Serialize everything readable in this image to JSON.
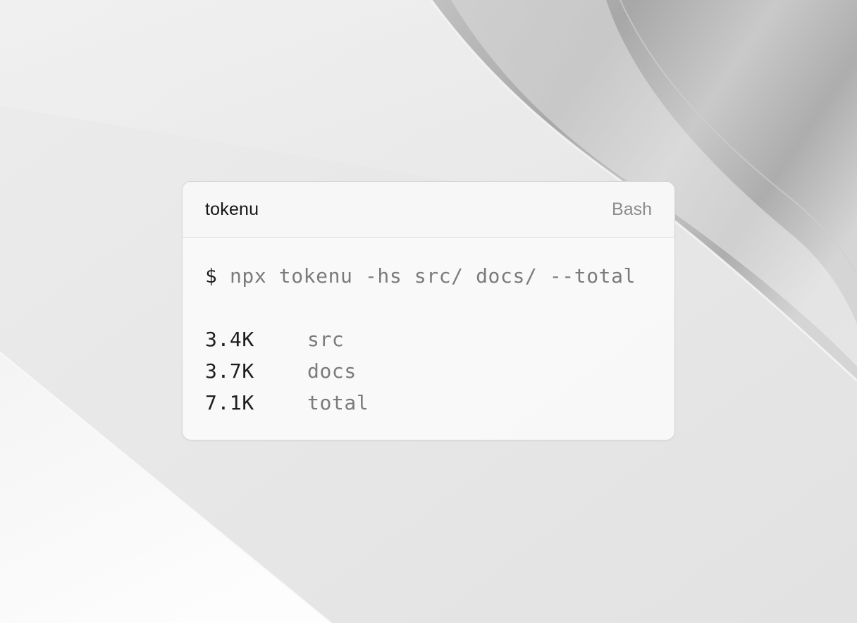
{
  "background": {
    "base_color": "#e6e6e6",
    "accent_light": "#fafafa",
    "accent_dark": "#8e8e8e"
  },
  "terminal": {
    "title": "tokenu",
    "language": "Bash",
    "prompt": "$",
    "command": "npx tokenu -hs src/ docs/ --total",
    "output": [
      {
        "size": "3.4K",
        "name": "src"
      },
      {
        "size": "3.7K",
        "name": "docs"
      },
      {
        "size": "7.1K",
        "name": "total"
      }
    ]
  }
}
